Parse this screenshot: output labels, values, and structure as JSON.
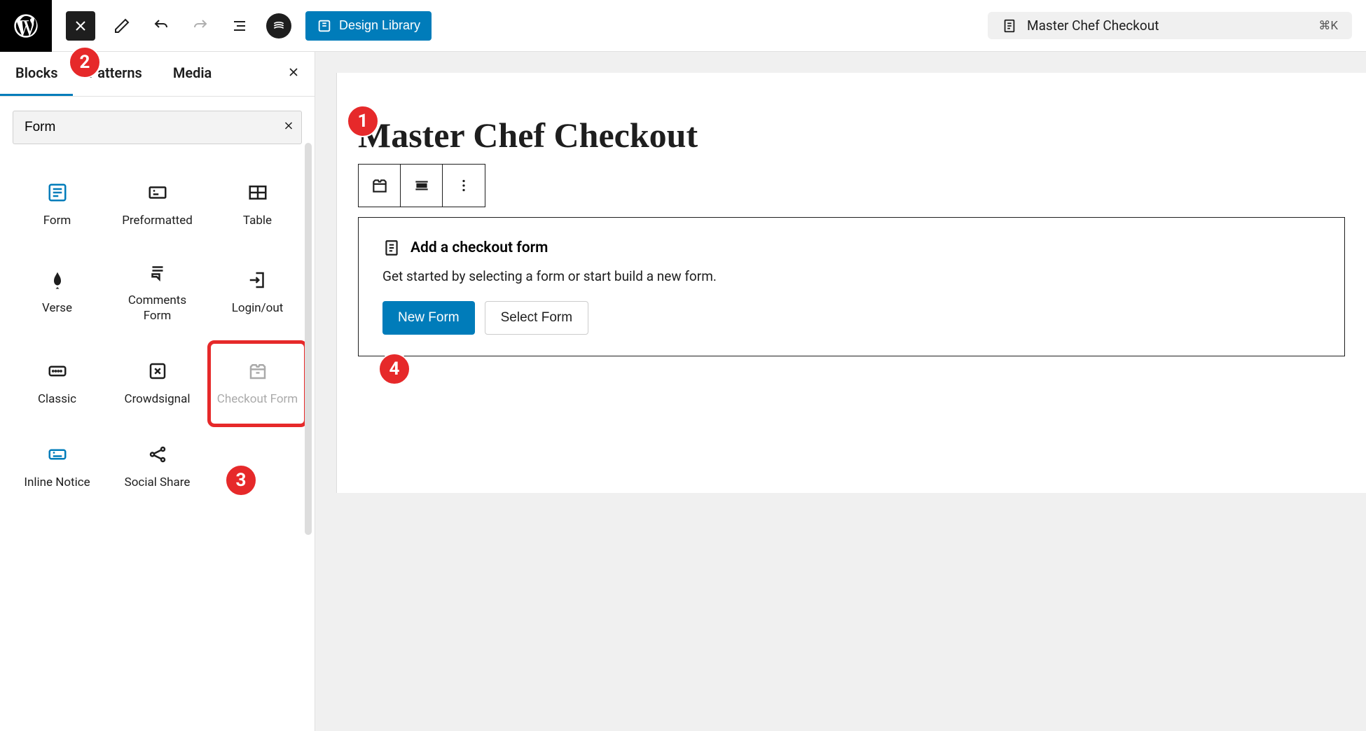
{
  "toolbar": {
    "design_library": "Design Library",
    "doc_title": "Master Chef Checkout",
    "shortcut": "⌘K"
  },
  "sidebar": {
    "tabs": {
      "blocks": "Blocks",
      "patterns": "Patterns",
      "media": "Media"
    },
    "search_value": "Form",
    "blocks": [
      {
        "label": "Form"
      },
      {
        "label": "Preformatted"
      },
      {
        "label": "Table"
      },
      {
        "label": "Verse"
      },
      {
        "label": "Comments Form"
      },
      {
        "label": "Login/out"
      },
      {
        "label": "Classic"
      },
      {
        "label": "Crowdsignal"
      },
      {
        "label": "Checkout Form"
      },
      {
        "label": "Inline Notice"
      },
      {
        "label": "Social Share"
      }
    ]
  },
  "editor": {
    "page_title": "Master Chef Checkout",
    "placeholder": {
      "title": "Add a checkout form",
      "desc": "Get started by selecting a form or start build a new form.",
      "new_form": "New Form",
      "select_form": "Select Form"
    }
  },
  "annotations": {
    "a1": "1",
    "a2": "2",
    "a3": "3",
    "a4": "4"
  }
}
